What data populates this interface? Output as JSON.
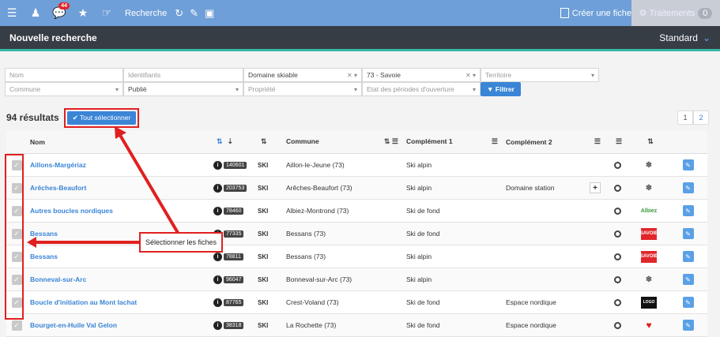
{
  "topbar": {
    "notifications_count": "44",
    "search_label": "Recherche",
    "create_label": "Créer une fiche",
    "traitements_label": "Traitements",
    "traitements_count": "0"
  },
  "title": {
    "main": "Nouvelle recherche",
    "mode": "Standard"
  },
  "filters": {
    "nom": "Nom",
    "identifiants": "Identifiants",
    "domaine": "Domaine skiable",
    "departement": "73 - Savoie",
    "territoire": "Territoire",
    "commune": "Commune",
    "publie": "Publié",
    "propriete": "Propriété",
    "etat": "Etat des périodes d'ouverture",
    "filter_btn": "Filtrer"
  },
  "results": {
    "count": "94 résultats",
    "select_all": "Tout sélectionner"
  },
  "pager": [
    "1",
    "2"
  ],
  "headers": {
    "nom": "Nom",
    "commune": "Commune",
    "complement1": "Complément 1",
    "complement2": "Complément 2"
  },
  "rows": [
    {
      "nom": "Aillons-Margériaz",
      "id": "140601",
      "type": "SKI",
      "commune": "Aillon-le-Jeune (73)",
      "c1": "Ski alpin",
      "c2": ""
    },
    {
      "nom": "Arêches-Beaufort",
      "id": "203753",
      "type": "SKI",
      "commune": "Arêches-Beaufort (73)",
      "c1": "Ski alpin",
      "c2": "Domaine station"
    },
    {
      "nom": "Autres boucles nordiques",
      "id": "78460",
      "type": "SKI",
      "commune": "Albiez-Montrond (73)",
      "c1": "Ski de fond",
      "c2": ""
    },
    {
      "nom": "Bessans",
      "id": "77335",
      "type": "SKI",
      "commune": "Bessans (73)",
      "c1": "Ski de fond",
      "c2": ""
    },
    {
      "nom": "Bessans",
      "id": "78811",
      "type": "SKI",
      "commune": "Bessans (73)",
      "c1": "Ski alpin",
      "c2": ""
    },
    {
      "nom": "Bonneval-sur-Arc",
      "id": "96047",
      "type": "SKI",
      "commune": "Bonneval-sur-Arc (73)",
      "c1": "Ski alpin",
      "c2": ""
    },
    {
      "nom": "Boucle d'initiation au Mont Iachat",
      "id": "87765",
      "type": "SKI",
      "commune": "Crest-Voland (73)",
      "c1": "Ski de fond",
      "c2": "Espace nordique"
    },
    {
      "nom": "Bourget-en-Huile Val Gelon",
      "id": "38318",
      "type": "SKI",
      "commune": "La Rochette (73)",
      "c1": "Ski de fond",
      "c2": "Espace nordique"
    }
  ],
  "callout": "Sélectionner les fiches"
}
